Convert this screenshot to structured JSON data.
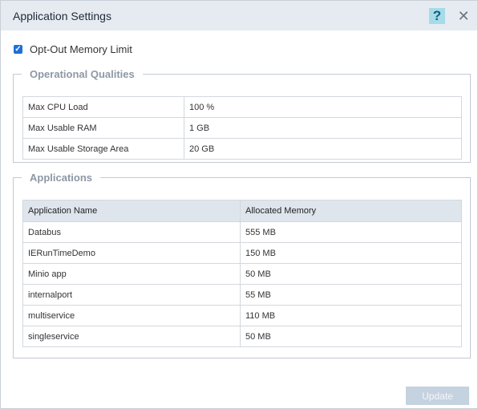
{
  "dialog": {
    "title": "Application Settings",
    "help_glyph": "?",
    "close_glyph": "✕"
  },
  "optout": {
    "checked": true,
    "label": "Opt-Out Memory Limit"
  },
  "operational": {
    "legend": "Operational Qualities",
    "rows": [
      {
        "key": "Max CPU Load",
        "value": "100 %"
      },
      {
        "key": "Max Usable RAM",
        "value": "1 GB"
      },
      {
        "key": "Max Usable Storage Area",
        "value": "20 GB"
      }
    ]
  },
  "applications": {
    "legend": "Applications",
    "headers": [
      "Application Name",
      "Allocated Memory"
    ],
    "rows": [
      {
        "name": "Databus",
        "memory": "555 MB"
      },
      {
        "name": "IERunTimeDemo",
        "memory": "150 MB"
      },
      {
        "name": "Minio app",
        "memory": "50 MB"
      },
      {
        "name": "internalport",
        "memory": "55 MB"
      },
      {
        "name": "multiservice",
        "memory": "110 MB"
      },
      {
        "name": "singleservice",
        "memory": "50 MB"
      }
    ]
  },
  "footer": {
    "update_label": "Update"
  },
  "colors": {
    "accent": "#1e6fd9",
    "titlebar": "#e6ebf2",
    "help_bg": "#a6dbe7",
    "disabled_btn": "#c5d2e0"
  }
}
